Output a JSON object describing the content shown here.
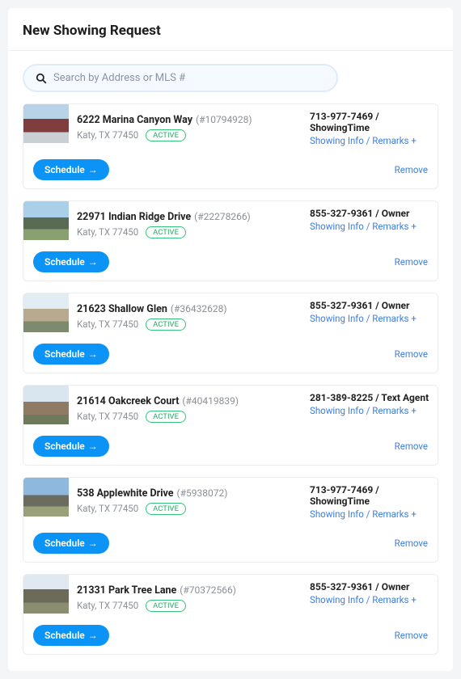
{
  "title": "New Showing Request",
  "search": {
    "placeholder": "Search by Address or MLS #"
  },
  "labels": {
    "schedule": "Schedule",
    "arrow": "→",
    "remove": "Remove",
    "showing_info": "Showing Info / Remarks",
    "plus": "+"
  },
  "listings": [
    {
      "address": "6222 Marina Canyon Way",
      "mls": "(#10794928)",
      "city": "Katy, TX 77450",
      "status": "ACTIVE",
      "phone": "713-977-7469",
      "contact": "ShowingTime"
    },
    {
      "address": "22971 Indian Ridge Drive",
      "mls": "(#22278266)",
      "city": "Katy, TX 77450",
      "status": "ACTIVE",
      "phone": "855-327-9361",
      "contact": "Owner"
    },
    {
      "address": "21623 Shallow Glen",
      "mls": "(#36432628)",
      "city": "Katy, TX 77450",
      "status": "ACTIVE",
      "phone": "855-327-9361",
      "contact": "Owner"
    },
    {
      "address": "21614 Oakcreek Court",
      "mls": "(#40419839)",
      "city": "Katy, TX 77450",
      "status": "ACTIVE",
      "phone": "281-389-8225",
      "contact": "Text Agent"
    },
    {
      "address": "538 Applewhite Drive",
      "mls": "(#5938072)",
      "city": "Katy, TX 77450",
      "status": "ACTIVE",
      "phone": "713-977-7469",
      "contact": "ShowingTime"
    },
    {
      "address": "21331 Park Tree Lane",
      "mls": "(#70372566)",
      "city": "Katy, TX 77450",
      "status": "ACTIVE",
      "phone": "855-327-9361",
      "contact": "Owner"
    }
  ]
}
